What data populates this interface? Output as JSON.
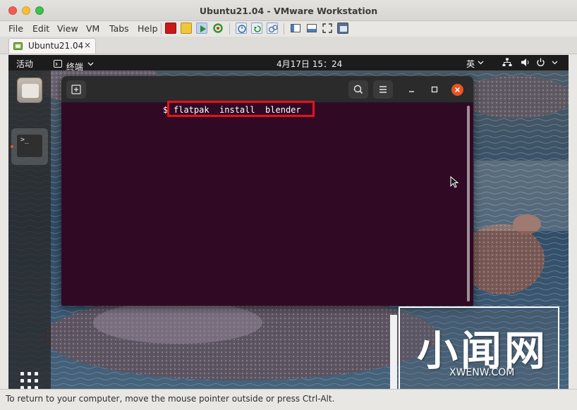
{
  "window": {
    "title": "Ubuntu21.04 - VMware Workstation"
  },
  "menubar": {
    "items": [
      "File",
      "Edit",
      "View",
      "VM",
      "Tabs",
      "Help"
    ]
  },
  "toolbar": {
    "icons": [
      "power-icon",
      "suspend-icon",
      "resume-icon",
      "reset-icon",
      "snapshot-icon",
      "revert-snapshot-icon",
      "manage-snapshots-icon",
      "console-view-icon",
      "unity-icon",
      "fullscreen-icon",
      "thumbnail-icon"
    ]
  },
  "tabs": [
    {
      "label": "Ubuntu21.04",
      "close": "×"
    }
  ],
  "ubuntu": {
    "topbar": {
      "activities": "活动",
      "app_menu": "终端",
      "clock": "4月17日  15：24",
      "input_method": "英"
    },
    "terminal": {
      "prompt": "$",
      "command": "flatpak  install  blender"
    }
  },
  "watermark": {
    "logo": "小闻网",
    "url": "XWENW.COM"
  },
  "status": {
    "text": "To return to your computer, move the mouse pointer outside or press Ctrl-Alt."
  },
  "colors": {
    "terminal_bg": "#300a24",
    "ubuntu_orange": "#e95420",
    "highlight_box": "#e8101c"
  }
}
